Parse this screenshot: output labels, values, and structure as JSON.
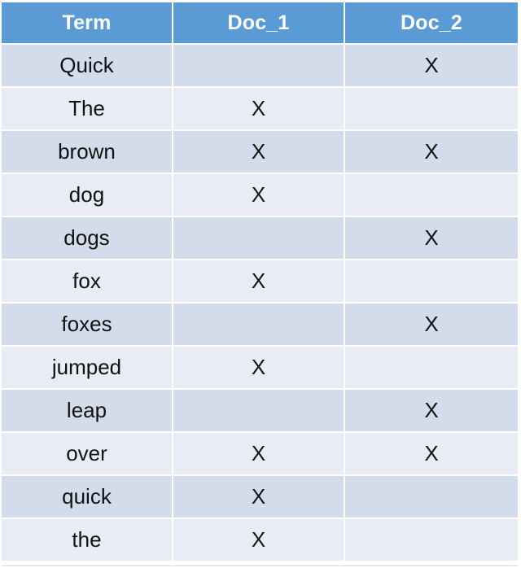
{
  "table": {
    "name": "term-document-incidence-matrix",
    "columns": [
      "Term",
      "Doc_1",
      "Doc_2"
    ],
    "mark_symbol": "X",
    "empty_symbol": "",
    "colors": {
      "header_background": "#5b9bd5",
      "header_text": "#ffffff",
      "row_odd_background": "#d3dcea",
      "row_even_background": "#e9ecf4",
      "cell_text": "#111111",
      "gridline": "#ffffff",
      "page_background": "#ffffff"
    },
    "rows": [
      {
        "term": "Quick",
        "doc_1": "",
        "doc_2": "X"
      },
      {
        "term": "The",
        "doc_1": "X",
        "doc_2": ""
      },
      {
        "term": "brown",
        "doc_1": "X",
        "doc_2": "X"
      },
      {
        "term": "dog",
        "doc_1": "X",
        "doc_2": ""
      },
      {
        "term": "dogs",
        "doc_1": "",
        "doc_2": "X"
      },
      {
        "term": "fox",
        "doc_1": "X",
        "doc_2": ""
      },
      {
        "term": "foxes",
        "doc_1": "",
        "doc_2": "X"
      },
      {
        "term": "jumped",
        "doc_1": "X",
        "doc_2": ""
      },
      {
        "term": "leap",
        "doc_1": "",
        "doc_2": "X"
      },
      {
        "term": "over",
        "doc_1": "X",
        "doc_2": "X"
      },
      {
        "term": "quick",
        "doc_1": "X",
        "doc_2": ""
      },
      {
        "term": "the",
        "doc_1": "X",
        "doc_2": ""
      }
    ]
  }
}
